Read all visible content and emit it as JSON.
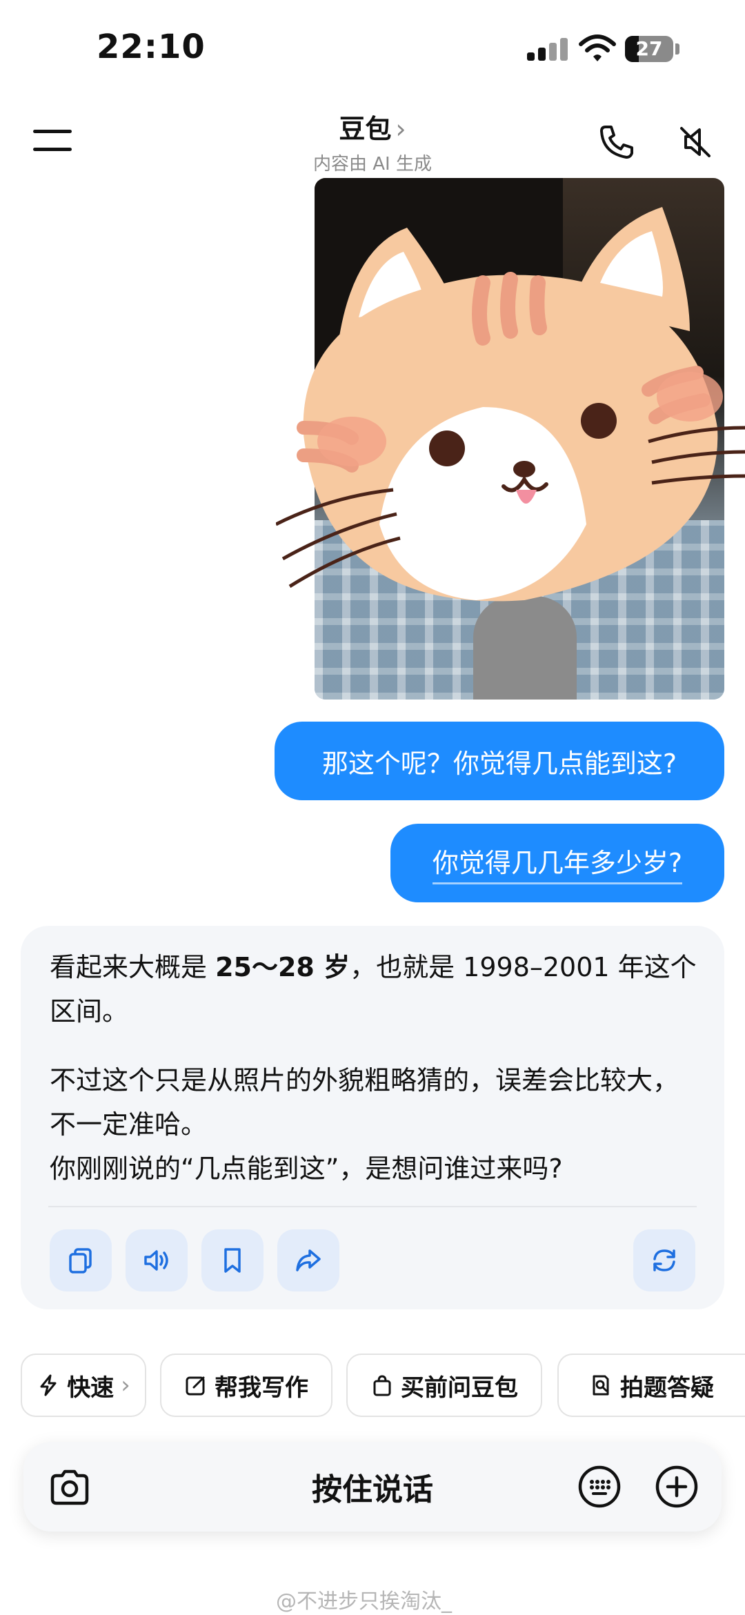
{
  "status_bar": {
    "time": "22:10",
    "battery": "27"
  },
  "header": {
    "title": "豆包",
    "chevron": "›",
    "subtitle": "内容由 AI 生成"
  },
  "messages": {
    "user_1": "那这个呢？你觉得几点能到这?",
    "user_2": "你觉得几几年多少岁?",
    "reply": {
      "p1_a": "看起来大概是 ",
      "p1_bold": "25～28 岁",
      "p1_b": "，也就是 1998–2001 年这个区间。",
      "p2_a": "不过这个只是从照片的外貌粗略猜的，误差会比较大，不一定准哈。",
      "p2_b": "你刚刚说的“几点能到这”，是想问谁过来吗?"
    },
    "actions": [
      "copy-icon",
      "speaker-icon",
      "bookmark-icon",
      "share-icon",
      "regenerate-icon"
    ]
  },
  "chips": [
    {
      "label": "快速",
      "suffix": "›",
      "icon": "bolt-icon"
    },
    {
      "label": "帮我写作",
      "icon": "edit-icon"
    },
    {
      "label": "买前问豆包",
      "icon": "bag-icon"
    },
    {
      "label": "拍题答疑",
      "icon": "search-doc-icon"
    }
  ],
  "input": {
    "hold_to_talk": "按住说话"
  },
  "watermark": "@不进步只挨淘汰_"
}
